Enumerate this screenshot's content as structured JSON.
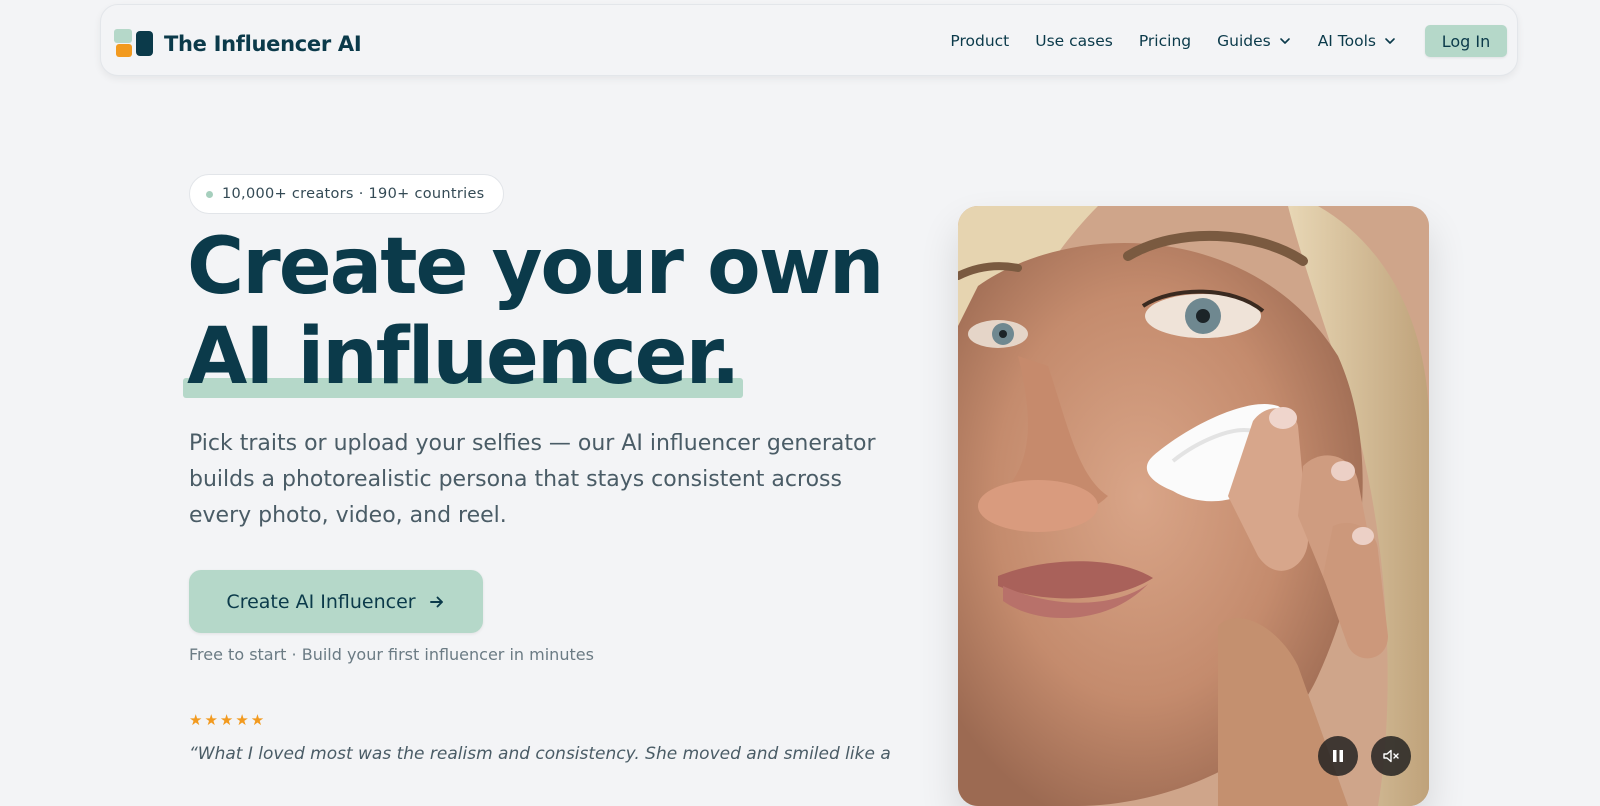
{
  "brand": {
    "name": "The Influencer AI",
    "colors": {
      "primary": "#0b3a4a",
      "accent": "#b5d8c9",
      "orange": "#f29a1f"
    }
  },
  "nav": {
    "links": [
      {
        "label": "Product"
      },
      {
        "label": "Use cases"
      },
      {
        "label": "Pricing"
      },
      {
        "label": "Guides",
        "dropdown": true
      },
      {
        "label": "AI Tools",
        "dropdown": true
      }
    ],
    "login_label": "Log In"
  },
  "hero": {
    "badge": "10,000+ creators · 190+ countries",
    "headline_line1": "Create your own",
    "headline_line2": "AI influencer.",
    "subcopy": "Pick traits or upload your selfies — our AI influencer generator builds a photorealistic persona that stays consistent across every photo, video, and reel.",
    "cta_label": "Create AI Influencer",
    "cta_note": "Free to start · Build your first influencer in minutes",
    "rating_stars": "★★★★★",
    "testimonial": "“What I loved most was the realism and consistency. She moved and smiled like a"
  },
  "media": {
    "controls": [
      {
        "icon": "pause-icon"
      },
      {
        "icon": "mute-icon"
      }
    ]
  }
}
